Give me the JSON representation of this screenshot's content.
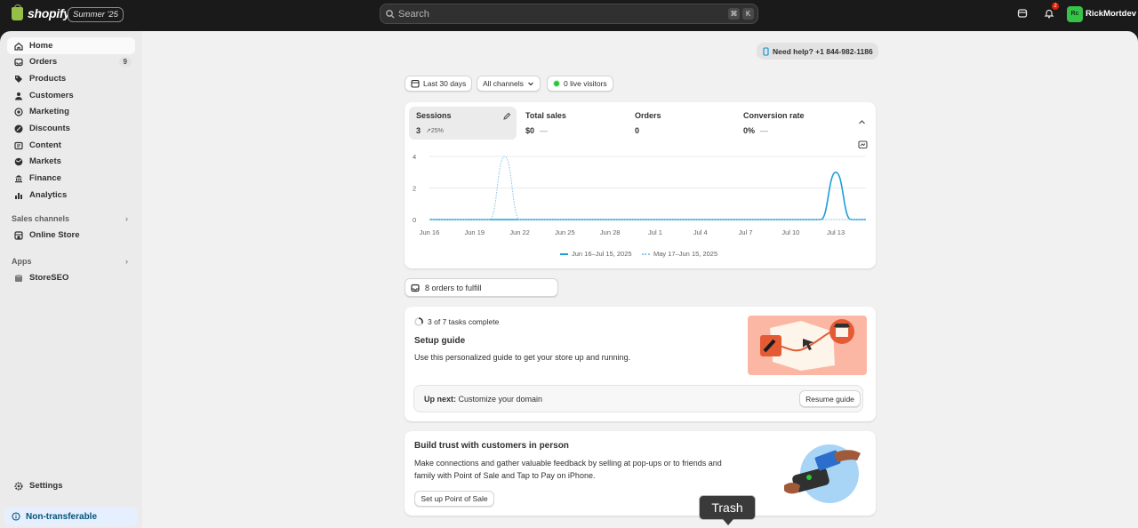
{
  "topbar": {
    "brand": "shopify",
    "edition_badge": "Summer '25",
    "search_placeholder": "Search",
    "shortcut_keys": [
      "⌘",
      "K"
    ],
    "notification_count": "2",
    "avatar_initials": "Rc",
    "username": "RickMortdev"
  },
  "sidebar": {
    "items": [
      {
        "label": "Home",
        "icon": "home-icon",
        "active": true
      },
      {
        "label": "Orders",
        "icon": "inbox-icon",
        "count": "9"
      },
      {
        "label": "Products",
        "icon": "tag-icon"
      },
      {
        "label": "Customers",
        "icon": "person-icon"
      },
      {
        "label": "Marketing",
        "icon": "target-icon"
      },
      {
        "label": "Discounts",
        "icon": "discount-icon"
      },
      {
        "label": "Content",
        "icon": "content-icon"
      },
      {
        "label": "Markets",
        "icon": "globe-icon"
      },
      {
        "label": "Finance",
        "icon": "bank-icon"
      },
      {
        "label": "Analytics",
        "icon": "chart-icon"
      }
    ],
    "sales_channels_label": "Sales channels",
    "online_store_label": "Online Store",
    "apps_label": "Apps",
    "storeseo_label": "StoreSEO",
    "settings_label": "Settings",
    "nontransferable_label": "Non-transferable"
  },
  "header": {
    "help_text": "Need help? +1 844-982-1186",
    "date_filter": "Last 30 days",
    "channel_filter": "All channels",
    "live_visitors": "0 live visitors"
  },
  "metrics": [
    {
      "label": "Sessions",
      "value": "3",
      "trend": "25%"
    },
    {
      "label": "Total sales",
      "value": "$0",
      "trend": "—"
    },
    {
      "label": "Orders",
      "value": "0",
      "trend": ""
    },
    {
      "label": "Conversion rate",
      "value": "0%",
      "trend": "—"
    }
  ],
  "chart_data": {
    "type": "line",
    "x": [
      "Jun 16",
      "Jun 17",
      "Jun 18",
      "Jun 19",
      "Jun 20",
      "Jun 21",
      "Jun 22",
      "Jun 23",
      "Jun 24",
      "Jun 25",
      "Jun 26",
      "Jun 27",
      "Jun 28",
      "Jun 29",
      "Jun 30",
      "Jul 1",
      "Jul 2",
      "Jul 3",
      "Jul 4",
      "Jul 5",
      "Jul 6",
      "Jul 7",
      "Jul 8",
      "Jul 9",
      "Jul 10",
      "Jul 11",
      "Jul 12",
      "Jul 13",
      "Jul 14",
      "Jul 15"
    ],
    "tick_labels": [
      "Jun 16",
      "Jun 19",
      "Jun 22",
      "Jun 25",
      "Jun 28",
      "Jul 1",
      "Jul 4",
      "Jul 7",
      "Jul 10",
      "Jul 13"
    ],
    "y_ticks": [
      "4",
      "2",
      "0"
    ],
    "ylim": [
      0,
      4
    ],
    "series": [
      {
        "name": "Jun 16–Jul 15, 2025",
        "style": "solid",
        "color": "#1b9ed8",
        "values": [
          0,
          0,
          0,
          0,
          0,
          0,
          0,
          0,
          0,
          0,
          0,
          0,
          0,
          0,
          0,
          0,
          0,
          0,
          0,
          0,
          0,
          0,
          0,
          0,
          0,
          0,
          0,
          3,
          0,
          0
        ]
      },
      {
        "name": "May 17–Jun 15, 2025",
        "style": "dotted",
        "color": "#8fc7e8",
        "values": [
          0,
          0,
          0,
          0,
          0,
          4,
          0,
          0,
          0,
          0,
          0,
          0,
          0,
          0,
          0,
          0,
          0,
          0,
          0,
          0,
          0,
          0,
          0,
          0,
          0,
          0,
          0,
          0,
          0,
          0
        ]
      }
    ],
    "grid": true
  },
  "fulfill": {
    "label": "8 orders to fulfill"
  },
  "setup": {
    "tasks_text": "3 of 7 tasks complete",
    "title": "Setup guide",
    "description": "Use this personalized guide to get your store up and running.",
    "up_next_label": "Up next:",
    "up_next_text": "Customize your domain",
    "resume_button": "Resume guide"
  },
  "pos": {
    "title": "Build trust with customers in person",
    "description": "Make connections and gather valuable feedback by selling at pop-ups or to friends and family with Point of Sale and Tap to Pay on iPhone.",
    "button": "Set up Point of Sale"
  },
  "tooltip": {
    "text": "Trash"
  }
}
